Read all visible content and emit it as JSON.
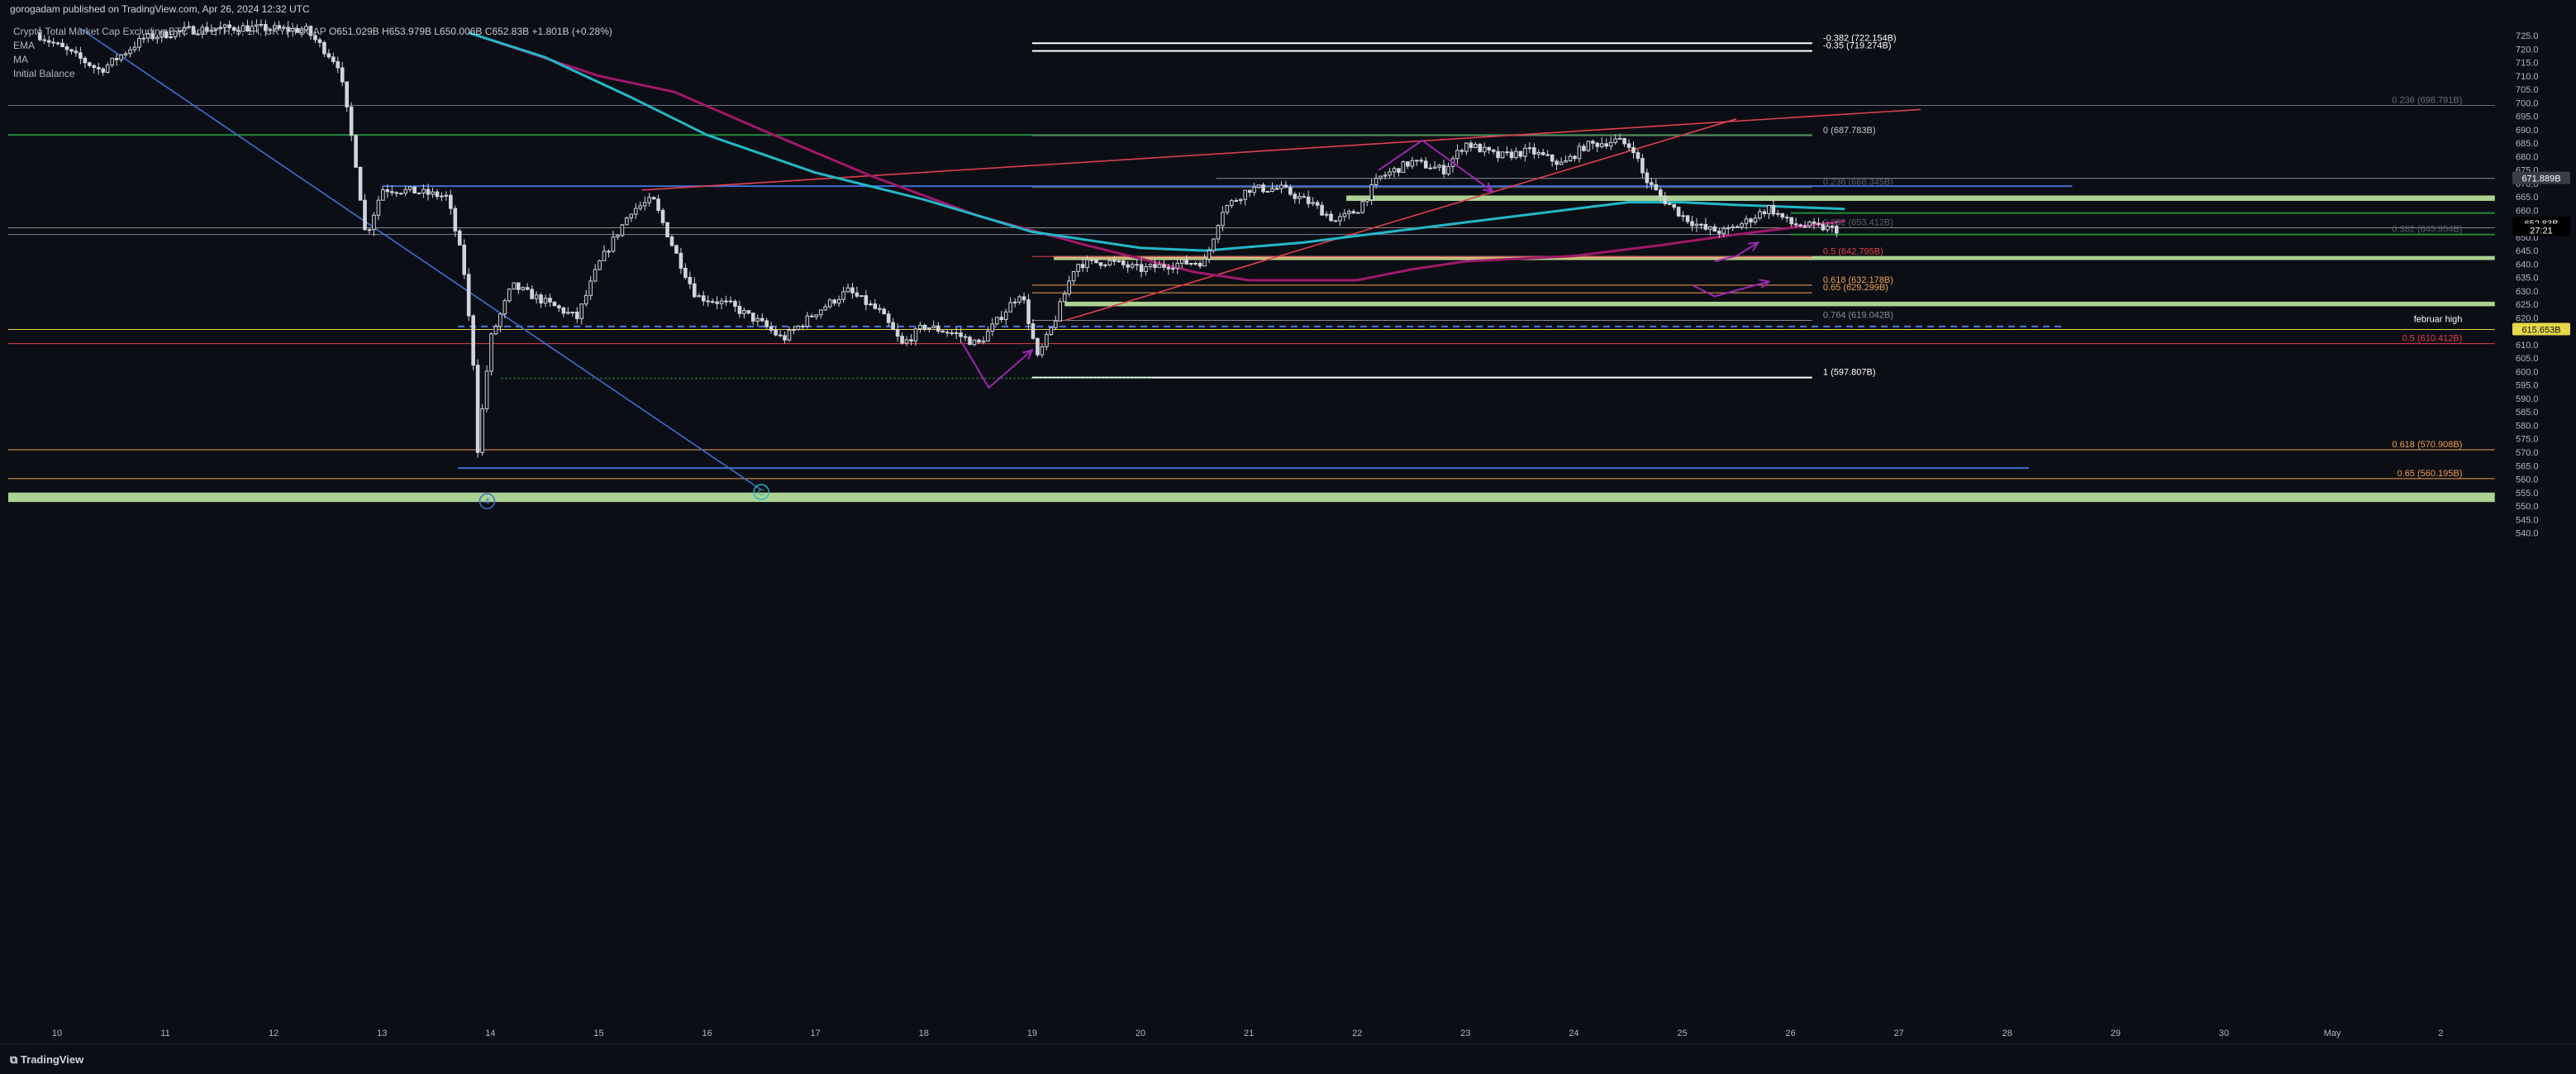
{
  "header": {
    "text": "gorogadam published on TradingView.com, Apr 26, 2024 12:32 UTC"
  },
  "legend": {
    "symbol": "Crypto Total Market Cap Excluding BTC and ETH, 5, 1H, CRYPTOCAP",
    "ohlc": "O651.029B H653.979B L650.006B C652.83B +1.801B (+0.28%)",
    "indicators": [
      "EMA",
      "MA",
      "Initial Balance"
    ]
  },
  "footer": {
    "brand": "TradingView"
  },
  "colors": {
    "background": "#0c0e15",
    "candle": "#d1d4dc",
    "ema": "#22b8c8",
    "ma": "#a0186a",
    "trend_red": "#e0404f",
    "blue_line": "#3f6fd0",
    "green_line": "#1f8a3a",
    "green_band": "#c8f5a8",
    "yellow": "#e6d84a",
    "orange": "#f0a050",
    "purple_arrow": "#9c27b0"
  },
  "chart_data": {
    "type": "candlestick",
    "title": "Crypto Total Market Cap Excluding BTC and ETH",
    "timeframe": "1H",
    "x_ticks": [
      "10",
      "11",
      "12",
      "13",
      "14",
      "15",
      "16",
      "17",
      "18",
      "19",
      "20",
      "21",
      "22",
      "23",
      "24",
      "25",
      "26",
      "27",
      "28",
      "29",
      "30",
      "May",
      "2"
    ],
    "y_ticks": [
      725,
      720,
      715,
      710,
      705,
      700,
      695,
      690,
      685,
      680,
      675,
      670,
      665,
      660,
      655,
      650,
      645,
      640,
      635,
      630,
      625,
      620,
      615,
      610,
      605,
      600,
      595,
      590,
      585,
      580,
      575,
      570,
      565,
      560,
      555,
      550,
      545,
      540
    ],
    "y_unit": "B",
    "ylim": [
      537,
      726
    ],
    "last_price": "652.83B",
    "countdown": "27:21",
    "price_labels": [
      {
        "text": "671.889B",
        "price": 671.9
      },
      {
        "text": "615.653B",
        "price": 615.65
      }
    ],
    "close_path": [
      {
        "day": 9.8,
        "price": 726
      },
      {
        "day": 10.4,
        "price": 712
      },
      {
        "day": 10.8,
        "price": 724
      },
      {
        "day": 11.2,
        "price": 727
      },
      {
        "day": 11.7,
        "price": 728
      },
      {
        "day": 12.3,
        "price": 727
      },
      {
        "day": 12.6,
        "price": 714
      },
      {
        "day": 12.75,
        "price": 680
      },
      {
        "day": 12.85,
        "price": 650
      },
      {
        "day": 13.0,
        "price": 668
      },
      {
        "day": 13.3,
        "price": 667
      },
      {
        "day": 13.6,
        "price": 665
      },
      {
        "day": 13.75,
        "price": 640
      },
      {
        "day": 13.85,
        "price": 600
      },
      {
        "day": 13.88,
        "price": 570
      },
      {
        "day": 14.0,
        "price": 612
      },
      {
        "day": 14.2,
        "price": 632
      },
      {
        "day": 14.5,
        "price": 626
      },
      {
        "day": 14.8,
        "price": 620
      },
      {
        "day": 15.0,
        "price": 640
      },
      {
        "day": 15.3,
        "price": 660
      },
      {
        "day": 15.5,
        "price": 664
      },
      {
        "day": 15.7,
        "price": 645
      },
      {
        "day": 15.9,
        "price": 628
      },
      {
        "day": 16.2,
        "price": 625
      },
      {
        "day": 16.5,
        "price": 618
      },
      {
        "day": 16.7,
        "price": 612
      },
      {
        "day": 17.0,
        "price": 622
      },
      {
        "day": 17.3,
        "price": 630
      },
      {
        "day": 17.6,
        "price": 622
      },
      {
        "day": 17.8,
        "price": 610
      },
      {
        "day": 18.0,
        "price": 617
      },
      {
        "day": 18.3,
        "price": 614
      },
      {
        "day": 18.5,
        "price": 610
      },
      {
        "day": 18.7,
        "price": 620
      },
      {
        "day": 18.9,
        "price": 630
      },
      {
        "day": 19.05,
        "price": 605
      },
      {
        "day": 19.2,
        "price": 618
      },
      {
        "day": 19.4,
        "price": 640
      },
      {
        "day": 19.7,
        "price": 641
      },
      {
        "day": 20.0,
        "price": 638
      },
      {
        "day": 20.3,
        "price": 640
      },
      {
        "day": 20.6,
        "price": 641
      },
      {
        "day": 20.75,
        "price": 660
      },
      {
        "day": 21.0,
        "price": 668
      },
      {
        "day": 21.3,
        "price": 668
      },
      {
        "day": 21.6,
        "price": 662
      },
      {
        "day": 21.8,
        "price": 656
      },
      {
        "day": 22.0,
        "price": 660
      },
      {
        "day": 22.2,
        "price": 672
      },
      {
        "day": 22.5,
        "price": 678
      },
      {
        "day": 22.8,
        "price": 675
      },
      {
        "day": 23.0,
        "price": 685
      },
      {
        "day": 23.3,
        "price": 680
      },
      {
        "day": 23.6,
        "price": 682
      },
      {
        "day": 23.9,
        "price": 677
      },
      {
        "day": 24.1,
        "price": 684
      },
      {
        "day": 24.4,
        "price": 686
      },
      {
        "day": 24.55,
        "price": 683
      },
      {
        "day": 24.65,
        "price": 672
      },
      {
        "day": 24.8,
        "price": 665
      },
      {
        "day": 25.0,
        "price": 658
      },
      {
        "day": 25.2,
        "price": 653
      },
      {
        "day": 25.4,
        "price": 652
      },
      {
        "day": 25.6,
        "price": 656
      },
      {
        "day": 25.8,
        "price": 661
      },
      {
        "day": 26.0,
        "price": 655
      },
      {
        "day": 26.2,
        "price": 654
      },
      {
        "day": 26.45,
        "price": 652.8
      }
    ],
    "ema_path": [
      {
        "day": 13.8,
        "price": 726
      },
      {
        "day": 14.5,
        "price": 717
      },
      {
        "day": 15.3,
        "price": 702
      },
      {
        "day": 16.0,
        "price": 688
      },
      {
        "day": 17.0,
        "price": 674
      },
      {
        "day": 18.0,
        "price": 664
      },
      {
        "day": 19.0,
        "price": 652
      },
      {
        "day": 20.0,
        "price": 646
      },
      {
        "day": 20.6,
        "price": 645
      },
      {
        "day": 21.5,
        "price": 648
      },
      {
        "day": 22.5,
        "price": 653
      },
      {
        "day": 23.5,
        "price": 658
      },
      {
        "day": 24.5,
        "price": 663
      },
      {
        "day": 25.0,
        "price": 663
      },
      {
        "day": 25.5,
        "price": 662
      },
      {
        "day": 26.5,
        "price": 660.5
      }
    ],
    "ma_path": [
      {
        "day": 13.8,
        "price": 726
      },
      {
        "day": 15.0,
        "price": 710
      },
      {
        "day": 15.7,
        "price": 704
      },
      {
        "day": 16.5,
        "price": 690
      },
      {
        "day": 17.5,
        "price": 673
      },
      {
        "day": 18.5,
        "price": 658
      },
      {
        "day": 19.5,
        "price": 647
      },
      {
        "day": 20.5,
        "price": 637
      },
      {
        "day": 21.0,
        "price": 634
      },
      {
        "day": 22.0,
        "price": 634
      },
      {
        "day": 22.5,
        "price": 638
      },
      {
        "day": 23.0,
        "price": 641
      },
      {
        "day": 24.0,
        "price": 643
      },
      {
        "day": 24.8,
        "price": 647
      },
      {
        "day": 25.5,
        "price": 651
      },
      {
        "day": 26.5,
        "price": 656
      }
    ],
    "horizontal_lines": [
      {
        "price": 722.154,
        "day_from": 19.0,
        "day_to": 26.2,
        "color": "#ffffff",
        "width": 2
      },
      {
        "price": 719.274,
        "day_from": 19.0,
        "day_to": 26.2,
        "color": "#ffffff",
        "width": 2
      },
      {
        "price": 699,
        "day_from": 9.0,
        "day_to": 32.5,
        "color": "#6b6f7a",
        "width": 1
      },
      {
        "price": 688,
        "day_from": 9.0,
        "day_to": 26.2,
        "color": "#1f8a3a",
        "width": 2
      },
      {
        "price": 687.783,
        "day_from": 19.0,
        "day_to": 26.2,
        "color": "#8a8a8a",
        "width": 1
      },
      {
        "price": 671.889,
        "day_from": 20.7,
        "day_to": 32.5,
        "color": "#8a8e99",
        "width": 1
      },
      {
        "price": 669,
        "day_from": 13.0,
        "day_to": 28.6,
        "color": "#3f6fd0",
        "width": 2
      },
      {
        "price": 668.5,
        "day_from": 19.0,
        "day_to": 26.2,
        "color": "#6b6f7a",
        "width": 1
      },
      {
        "price": 659,
        "day_from": 26.0,
        "day_to": 32.5,
        "color": "#1f8a3a",
        "width": 2
      },
      {
        "price": 653.5,
        "day_from": 9.0,
        "day_to": 32.5,
        "color": "#8a8a8a",
        "width": 1
      },
      {
        "price": 651,
        "day_from": 9.0,
        "day_to": 32.5,
        "color": "#7a7fa0",
        "width": 1
      },
      {
        "price": 651,
        "day_from": 26.0,
        "day_to": 32.5,
        "color": "#1f8a3a",
        "width": 2
      },
      {
        "price": 642.795,
        "day_from": 19.0,
        "day_to": 26.2,
        "color": "#e0404f",
        "width": 1
      },
      {
        "price": 642.2,
        "day_from": 19.2,
        "day_to": 26.2,
        "color": "#f0a050",
        "width": 1
      },
      {
        "price": 632.178,
        "day_from": 19.0,
        "day_to": 26.2,
        "color": "#f0a050",
        "width": 1
      },
      {
        "price": 629.299,
        "day_from": 19.0,
        "day_to": 26.2,
        "color": "#f0a050",
        "width": 1
      },
      {
        "price": 619.042,
        "day_from": 19.0,
        "day_to": 26.2,
        "color": "#8a8a8a",
        "width": 1
      },
      {
        "price": 615.653,
        "day_from": 9.0,
        "day_to": 32.5,
        "color": "#e6d84a",
        "width": 1
      },
      {
        "price": 610.412,
        "day_from": 9.0,
        "day_to": 32.5,
        "color": "#e0404f",
        "width": 1
      },
      {
        "price": 597.807,
        "day_from": 19.0,
        "day_to": 26.2,
        "color": "#ffffff",
        "width": 2
      },
      {
        "price": 570.908,
        "day_from": 9.0,
        "day_to": 32.5,
        "color": "#f0a050",
        "width": 1
      },
      {
        "price": 564.1,
        "day_from": 13.7,
        "day_to": 28.2,
        "color": "#3f6fd0",
        "width": 2
      },
      {
        "price": 560.195,
        "day_from": 9.0,
        "day_to": 32.5,
        "color": "#f0a050",
        "width": 1
      }
    ],
    "dashed_lines": [
      {
        "price": 616.8,
        "day_from": 13.7,
        "day_to": 28.5,
        "color": "#4a78e0"
      }
    ],
    "dotted_lines": [
      {
        "price": 597.5,
        "day_from": 14.1,
        "day_to": 20.1,
        "color": "#1f8a3a"
      }
    ],
    "zones": [
      {
        "from": 663.5,
        "to": 665.5,
        "day_from": 21.9,
        "day_to": 32.5
      },
      {
        "from": 641.5,
        "to": 643.0,
        "day_from": 19.2,
        "day_to": 32.5
      },
      {
        "from": 624.3,
        "to": 626.0,
        "day_from": 19.3,
        "day_to": 32.5
      },
      {
        "from": 551.5,
        "to": 555.0,
        "day_from": 9.0,
        "day_to": 32.5
      }
    ],
    "trendlines": [
      {
        "d1": 15.4,
        "p1": 667.5,
        "d2": 27.2,
        "p2": 697.5,
        "color": "#e0404f"
      },
      {
        "d1": 19.3,
        "p1": 619,
        "d2": 25.5,
        "p2": 694,
        "color": "#e0404f"
      },
      {
        "d1": 10.2,
        "p1": 728,
        "d2": 16.5,
        "p2": 556,
        "color": "#3f6fd0"
      }
    ],
    "arrows": [
      {
        "points": [
          [
            18.35,
            611
          ],
          [
            18.6,
            594
          ],
          [
            19.0,
            608
          ]
        ]
      },
      {
        "points": [
          [
            22.2,
            675
          ],
          [
            22.6,
            686
          ],
          [
            23.25,
            667
          ]
        ]
      },
      {
        "points": [
          [
            25.3,
            641
          ],
          [
            25.5,
            643
          ],
          [
            25.7,
            648
          ]
        ]
      },
      {
        "points": [
          [
            25.1,
            632
          ],
          [
            25.3,
            628
          ],
          [
            25.8,
            633.5
          ]
        ]
      }
    ],
    "level_labels": [
      {
        "text": "-0.382 (722.154B)",
        "price": 722.154,
        "day": 26.3,
        "color": "#ffffff"
      },
      {
        "text": "-0.35 (719.274B)",
        "price": 719.274,
        "day": 26.3,
        "color": "#ffffff"
      },
      {
        "text": "0.236 (698.791B)",
        "price": 699,
        "day": 32.2,
        "color": "#6b6f7a",
        "align": "end"
      },
      {
        "text": "0 (687.783B)",
        "price": 687.783,
        "day": 26.3,
        "color": "#c9cbd1"
      },
      {
        "text": "0.236 (668.345B)",
        "price": 668.5,
        "day": 26.3,
        "color": "#5a5e68"
      },
      {
        "text": "0.382 (653.412B)",
        "price": 653.5,
        "day": 26.3,
        "color": "#5a5e68"
      },
      {
        "text": "0.382 (645.954B)",
        "price": 651,
        "day": 32.2,
        "color": "#5a5e68",
        "align": "end"
      },
      {
        "text": "0.5 (642.795B)",
        "price": 642.795,
        "day": 26.3,
        "color": "#e0404f"
      },
      {
        "text": "0.618 (632.178B)",
        "price": 632.178,
        "day": 26.3,
        "color": "#f0a050"
      },
      {
        "text": "0.65 (629.299B)",
        "price": 629.299,
        "day": 26.3,
        "color": "#f0a050"
      },
      {
        "text": "0.764 (619.042B)",
        "price": 619.042,
        "day": 26.3,
        "color": "#8a8e99"
      },
      {
        "text": "februar high",
        "price": 617.5,
        "day": 32.2,
        "color": "#ffffff",
        "align": "end"
      },
      {
        "text": "0.5 (610.412B)",
        "price": 610.412,
        "day": 32.2,
        "color": "#e0404f",
        "align": "end"
      },
      {
        "text": "1 (597.807B)",
        "price": 597.807,
        "day": 26.3,
        "color": "#ffffff"
      },
      {
        "text": "0.618 (570.908B)",
        "price": 570.908,
        "day": 32.2,
        "color": "#f0a050",
        "align": "end"
      },
      {
        "text": "0.65 (560.195B)",
        "price": 560.195,
        "day": 32.2,
        "color": "#f0a050",
        "align": "end"
      }
    ],
    "wave_labels": [
      {
        "text": "4",
        "day": 13.97,
        "price": 551.8,
        "color": "#3f6fd0"
      },
      {
        "text": "C",
        "day": 16.5,
        "price": 555.2,
        "color": "#22b8c8"
      }
    ]
  }
}
